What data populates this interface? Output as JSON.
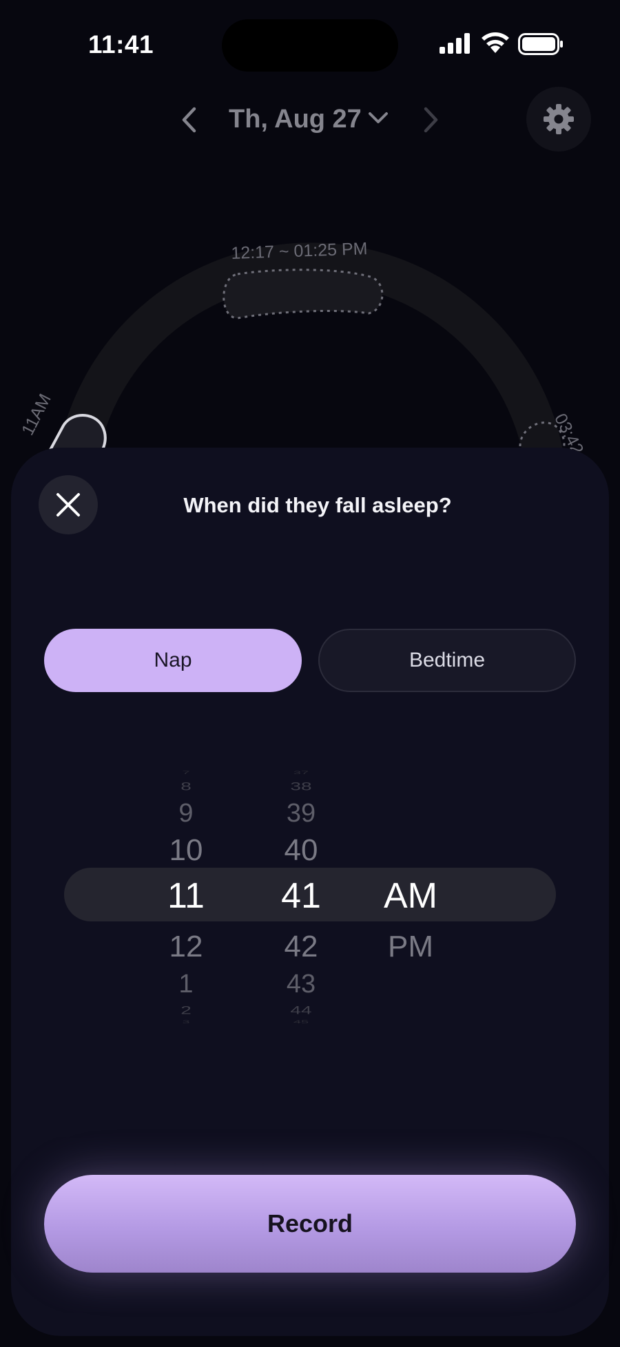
{
  "status_bar": {
    "time": "11:41"
  },
  "header": {
    "date": "Th, Aug 27",
    "icons": [
      "chevron-left-icon",
      "chevron-down-icon",
      "chevron-right-icon",
      "gear-icon"
    ]
  },
  "timeline": {
    "nap_range_label": "12:17 ~ 01:25",
    "nap_range_suffix": "PM",
    "left_time_label": "11AM",
    "right_time_label": "03:42"
  },
  "sheet": {
    "title": "When did they fall asleep?",
    "close_icon": "close-icon",
    "type_options": [
      "Nap",
      "Bedtime"
    ],
    "selected_type": "Nap",
    "picker": {
      "hours": [
        "7",
        "8",
        "9",
        "10",
        "11",
        "12",
        "1",
        "2",
        "3"
      ],
      "minutes": [
        "37",
        "38",
        "39",
        "40",
        "41",
        "42",
        "43",
        "44",
        "45"
      ],
      "periods": [
        "AM",
        "PM"
      ],
      "selected": {
        "hour": "11",
        "minute": "41",
        "period": "AM"
      }
    },
    "record_label": "Record"
  },
  "colors": {
    "background": "#07070f",
    "sheet": "#0f0f1f",
    "accent": "#cdb2f6"
  }
}
